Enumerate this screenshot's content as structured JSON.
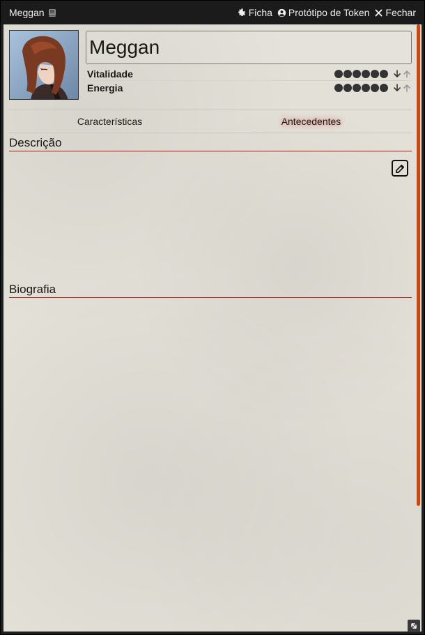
{
  "window": {
    "title": "Meggan",
    "controls": {
      "sheet": "Ficha",
      "token": "Protótipo de Token",
      "close": "Fechar"
    }
  },
  "character": {
    "name": "Meggan"
  },
  "stats": [
    {
      "label": "Vitalidade",
      "value": 6,
      "max": 6
    },
    {
      "label": "Energia",
      "value": 6,
      "max": 6
    }
  ],
  "tabs": [
    {
      "label": "Características",
      "active": false
    },
    {
      "label": "Antecedentes",
      "active": true
    }
  ],
  "sections": {
    "description": "Descrição",
    "biography": "Biografia"
  },
  "colors": {
    "accent": "#c14a1d",
    "section_rule": "#782e22",
    "background": "#e3e0d8"
  },
  "icons": [
    "book-icon",
    "gear-icon",
    "user-circle-icon",
    "close-icon",
    "arrow-down-icon",
    "arrow-up-icon",
    "edit-icon",
    "resize-icon"
  ]
}
